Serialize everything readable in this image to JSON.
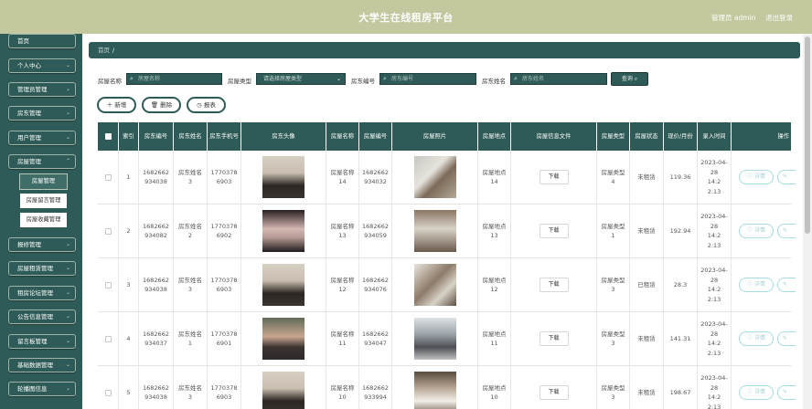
{
  "header": {
    "title": "大学生在线租房平台",
    "admin": "管理员 admin",
    "logout": "退出登录"
  },
  "sidebar": {
    "items": [
      "首页",
      "个人中心",
      "管理员管理",
      "房东管理",
      "用户管理",
      "房屋管理",
      "报修管理",
      "房屋租赁管理",
      "租房论坛管理",
      "公告信息管理",
      "留言板管理",
      "基础数据管理",
      "轮播图信息"
    ],
    "submenu": [
      "房屋管理",
      "房屋留言管理",
      "房屋收藏管理"
    ]
  },
  "breadcrumb": {
    "home": "首页",
    "sep": "/",
    "current": ""
  },
  "filters": {
    "name_label": "房屋名称",
    "name_placeholder": "房屋名称",
    "type_label": "房屋类型",
    "type_value": "请选择房屋类型",
    "code_label": "房东编号",
    "code_placeholder": "房东编号",
    "owner_label": "房东姓名",
    "owner_placeholder": "房东姓名",
    "query": "查询"
  },
  "actions": {
    "add": "新增",
    "delete": "删除",
    "report": "报表"
  },
  "table": {
    "headers": [
      "索引",
      "房东编号",
      "房东姓名",
      "房东手机号",
      "房东头像",
      "房屋名称",
      "房屋编号",
      "房屋照片",
      "房屋地点",
      "房屋信息文件",
      "房屋类型",
      "房屋状态",
      "现价/月份",
      "录入时间",
      "操作"
    ],
    "download": "下载",
    "detail": "详情",
    "rows": [
      {
        "idx": "1",
        "owner_code": "1682662934038",
        "owner_name": "房东姓名3",
        "phone": "17703786903",
        "name": "房屋名称14",
        "code": "1682662934032",
        "place": "房屋地点14",
        "type": "房屋类型4",
        "status": "未租赁",
        "price": "119.36",
        "time": "2023-04-28 14:22:13"
      },
      {
        "idx": "2",
        "owner_code": "1682662934082",
        "owner_name": "房东姓名2",
        "phone": "17703786902",
        "name": "房屋名称13",
        "code": "1682662934059",
        "place": "房屋地点13",
        "type": "房屋类型1",
        "status": "未租赁",
        "price": "192.94",
        "time": "2023-04-28 14:22:13"
      },
      {
        "idx": "3",
        "owner_code": "1682662934038",
        "owner_name": "房东姓名3",
        "phone": "17703786903",
        "name": "房屋名称12",
        "code": "1682662934076",
        "place": "房屋地点12",
        "type": "房屋类型3",
        "status": "已租赁",
        "price": "28.3",
        "time": "2023-04-28 14:22:13"
      },
      {
        "idx": "4",
        "owner_code": "1682662934037",
        "owner_name": "房东姓名1",
        "phone": "17703786901",
        "name": "房屋名称11",
        "code": "1682662934047",
        "place": "房屋地点11",
        "type": "房屋类型3",
        "status": "未租赁",
        "price": "141.31",
        "time": "2023-04-28 14:22:13"
      },
      {
        "idx": "5",
        "owner_code": "1682662934038",
        "owner_name": "房东姓名3",
        "phone": "17703786903",
        "name": "房屋名称10",
        "code": "1682662933994",
        "place": "房屋地点10",
        "type": "房屋类型3",
        "status": "未租赁",
        "price": "198.67",
        "time": "2023-04-28 14:22:13"
      }
    ]
  }
}
